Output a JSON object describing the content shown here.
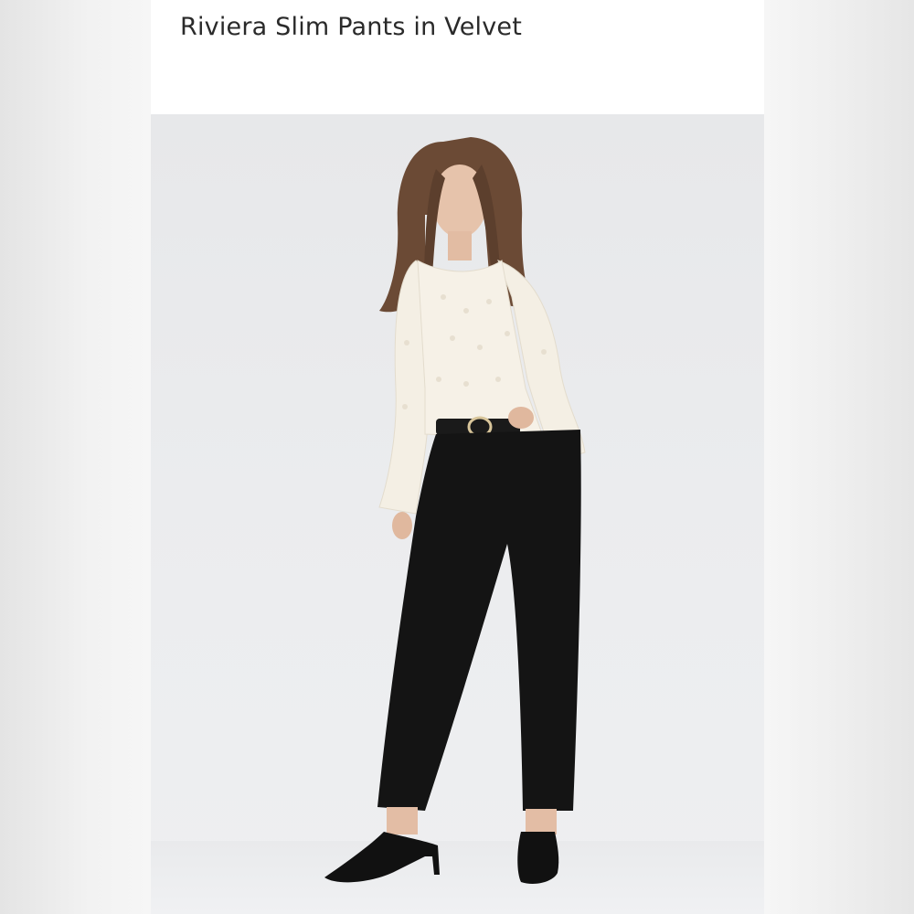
{
  "product": {
    "title": "Riviera Slim Pants in Velvet"
  },
  "colors": {
    "background": "#f0f0f0",
    "card": "#ffffff",
    "photo_backdrop": "#eaebed",
    "title_text": "#2a2a2a",
    "blouse": "#f4efe4",
    "pants": "#141414"
  }
}
